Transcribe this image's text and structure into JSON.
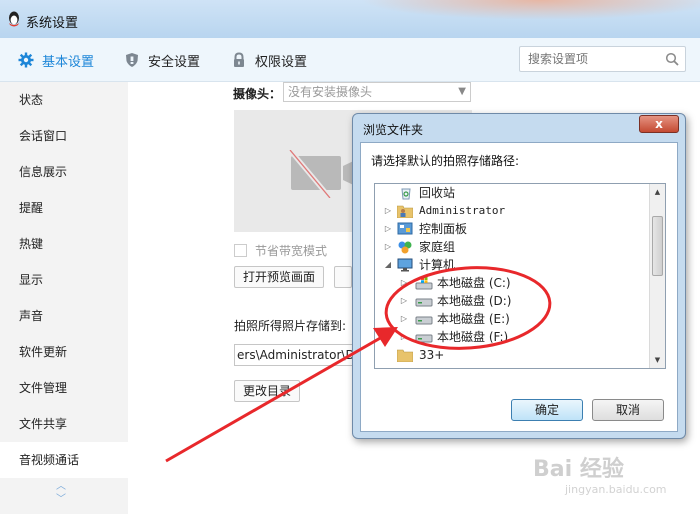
{
  "window": {
    "title": "系统设置"
  },
  "tabs": [
    {
      "label": "基本设置",
      "icon": "gear-icon",
      "active": true
    },
    {
      "label": "安全设置",
      "icon": "shield-icon",
      "active": false
    },
    {
      "label": "权限设置",
      "icon": "lock-icon",
      "active": false
    }
  ],
  "search": {
    "placeholder": "搜索设置项"
  },
  "sidebar": {
    "items": [
      {
        "label": "状态"
      },
      {
        "label": "会话窗口"
      },
      {
        "label": "信息展示"
      },
      {
        "label": "提醒"
      },
      {
        "label": "热键"
      },
      {
        "label": "显示"
      },
      {
        "label": "声音"
      },
      {
        "label": "软件更新"
      },
      {
        "label": "文件管理"
      },
      {
        "label": "文件共享"
      },
      {
        "label": "音视频通话",
        "active": true
      }
    ]
  },
  "main": {
    "camera_label": "摄像头：",
    "camera_select": "没有安装摄像头",
    "save_mode_label": "节省带宽模式",
    "open_preview_button": "打开预览画面",
    "photo_path_label": "拍照所得照片存储到:",
    "photo_path_value": "ers\\Administrator\\D",
    "change_dir_button": "更改目录"
  },
  "dialog": {
    "title": "浏览文件夹",
    "close_label": "x",
    "prompt": "请选择默认的拍照存储路径:",
    "tree": [
      {
        "label": "回收站",
        "icon": "recycle-bin-icon",
        "indent": 1,
        "expander": ""
      },
      {
        "label": "Administrator",
        "icon": "user-folder-icon",
        "indent": 0,
        "expander": "▷"
      },
      {
        "label": "控制面板",
        "icon": "control-panel-icon",
        "indent": 0,
        "expander": "▷"
      },
      {
        "label": "家庭组",
        "icon": "homegroup-icon",
        "indent": 0,
        "expander": "▷"
      },
      {
        "label": "计算机",
        "icon": "computer-icon",
        "indent": 0,
        "expander": "◢"
      },
      {
        "label": "本地磁盘 (C:)",
        "icon": "system-drive-icon",
        "indent": 1,
        "expander": "▷"
      },
      {
        "label": "本地磁盘 (D:)",
        "icon": "drive-icon",
        "indent": 1,
        "expander": "▷"
      },
      {
        "label": "本地磁盘 (E:)",
        "icon": "drive-icon",
        "indent": 1,
        "expander": "▷"
      },
      {
        "label": "本地磁盘 (F:)",
        "icon": "drive-icon",
        "indent": 1,
        "expander": "▷"
      },
      {
        "label": "33+",
        "icon": "folder-icon",
        "indent": 0,
        "expander": ""
      }
    ],
    "ok_button": "确定",
    "cancel_button": "取消"
  },
  "watermark": {
    "text": "Bai 经验",
    "url": "jingyan.baidu.com"
  },
  "colors": {
    "accent": "#1d86d8",
    "annotation": "#e8282b"
  }
}
